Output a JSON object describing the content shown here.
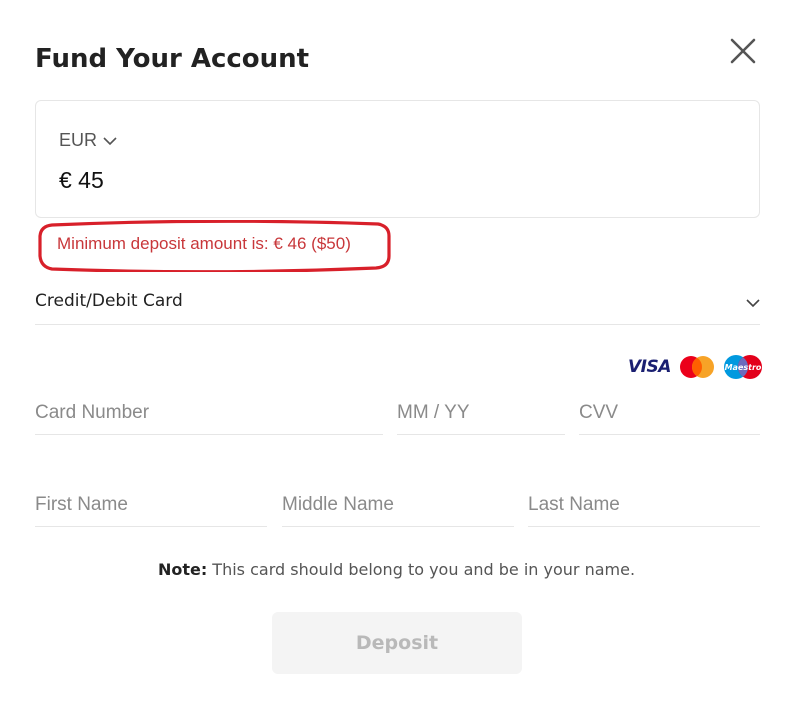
{
  "dialog": {
    "title": "Fund Your Account",
    "close_icon": "close-icon"
  },
  "amount": {
    "currency": "EUR",
    "value": "€ 45"
  },
  "error": {
    "message": "Minimum deposit amount is: € 46 ($50)",
    "color": "#c8373a",
    "highlight_color": "#d8202a"
  },
  "payment_method": {
    "selected": "Credit/Debit Card"
  },
  "card_logos": {
    "visa": "VISA",
    "maestro": "Maestro",
    "mastercard_icon": "mastercard-icon"
  },
  "fields": {
    "card_number": {
      "placeholder": "Card Number",
      "value": ""
    },
    "expiry": {
      "placeholder": "MM / YY",
      "value": ""
    },
    "cvv": {
      "placeholder": "CVV",
      "value": ""
    },
    "first_name": {
      "placeholder": "First Name",
      "value": ""
    },
    "middle_name": {
      "placeholder": "Middle Name",
      "value": ""
    },
    "last_name": {
      "placeholder": "Last Name",
      "value": ""
    }
  },
  "note": {
    "label": "Note:",
    "text": " This card should belong to you and be in your name."
  },
  "deposit_button": {
    "label": "Deposit",
    "enabled": false
  }
}
